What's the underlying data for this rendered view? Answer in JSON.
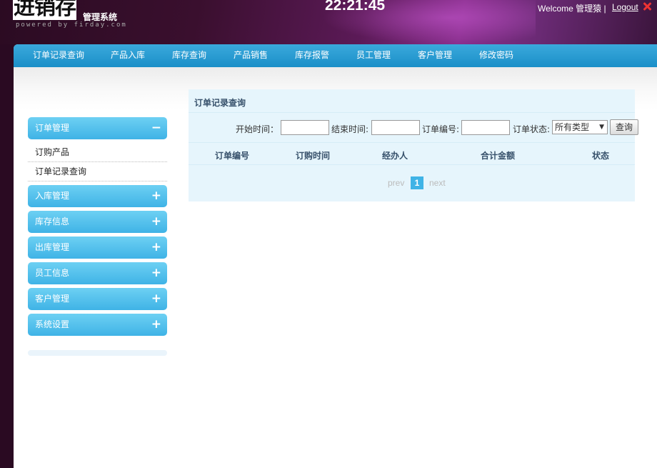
{
  "header": {
    "logo_main": "进销存",
    "logo_sub": "管理系统",
    "logo_powered": "powered by firday.com",
    "clock": "22:21:45",
    "welcome": "Welcome 管理猿 |",
    "logout_label": "Logout"
  },
  "nav": {
    "items": [
      "订单记录查询",
      "产品入库",
      "库存查询",
      "产品销售",
      "库存报警",
      "员工管理",
      "客户管理",
      "修改密码"
    ]
  },
  "sidebar": {
    "groups": [
      {
        "label": "订单管理",
        "sign": "−",
        "expanded": true
      },
      {
        "label": "入库管理",
        "sign": "+"
      },
      {
        "label": "库存信息",
        "sign": "+"
      },
      {
        "label": "出库管理",
        "sign": "+"
      },
      {
        "label": "员工信息",
        "sign": "+"
      },
      {
        "label": "客户管理",
        "sign": "+"
      },
      {
        "label": "系统设置",
        "sign": "+"
      }
    ],
    "sub_items": [
      "订购产品",
      "订单记录查询"
    ]
  },
  "content": {
    "title": "订单记录查询",
    "filters": {
      "start_label": "开始时间：",
      "end_label": "结束时间:",
      "order_no_label": "订单编号:",
      "status_label": "订单状态:",
      "status_value": "所有类型",
      "query_button": "查询"
    },
    "columns": [
      "订单编号",
      "订购时间",
      "经办人",
      "合计金额",
      "状态"
    ],
    "pager": {
      "prev": "prev",
      "current": "1",
      "next": "next"
    }
  },
  "colors": {
    "nav": "#1b8fc8",
    "side_head": "#4fbfed",
    "content_bg": "#e6f5fc",
    "accent": "#3fb3e6"
  }
}
